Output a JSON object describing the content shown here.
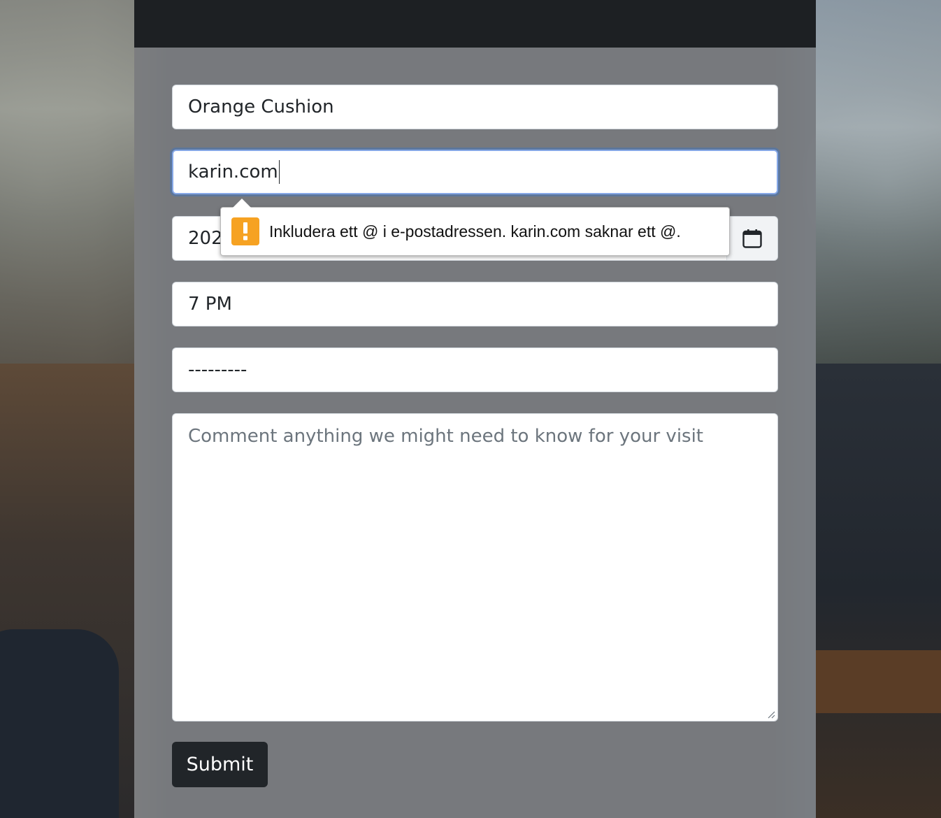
{
  "form": {
    "name_value": "Orange Cushion",
    "email_value": "karin.com",
    "date_value": "202",
    "time_value": "7 PM",
    "select_value": "---------",
    "comment_placeholder": "Comment anything we might need to know for your visit",
    "submit_label": "Submit"
  },
  "validation": {
    "message": "Inkludera ett @ i e-postadressen. karin.com saknar ett @.",
    "icon": "warning-icon",
    "color": "#f6a222"
  },
  "icons": {
    "calendar": "calendar-icon"
  }
}
